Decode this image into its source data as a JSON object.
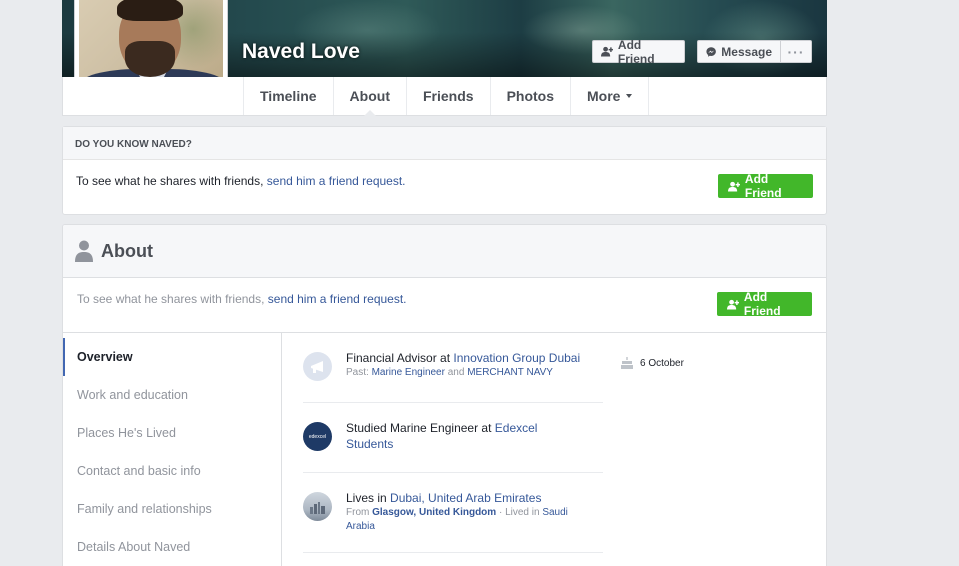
{
  "profile": {
    "name": "Naved Love"
  },
  "header_actions": {
    "add_friend": "Add Friend",
    "message": "Message",
    "more": "···"
  },
  "nav": {
    "tabs": [
      {
        "label": "Timeline"
      },
      {
        "label": "About"
      },
      {
        "label": "Friends"
      },
      {
        "label": "Photos"
      },
      {
        "label": "More"
      }
    ],
    "active_tab": "About"
  },
  "know_card": {
    "title": "DO YOU KNOW NAVED?",
    "text": "To see what he shares with friends, ",
    "link": "send him a friend request.",
    "button": "Add Friend"
  },
  "about": {
    "title": "About",
    "request_text": "To see what he shares with friends, ",
    "request_link": "send him a friend request.",
    "button": "Add Friend",
    "sidebar": [
      {
        "label": "Overview"
      },
      {
        "label": "Work and education"
      },
      {
        "label": "Places He's Lived"
      },
      {
        "label": "Contact and basic info"
      },
      {
        "label": "Family and relationships"
      },
      {
        "label": "Details About Naved"
      }
    ],
    "active_section": "Overview",
    "entries": [
      {
        "icon": "briefcase-icon",
        "main_prefix": "Financial Advisor at ",
        "main_link": "Innovation Group Dubai",
        "sub_prefix": "Past: ",
        "sub_link1": "Marine Engineer",
        "sub_mid": " and ",
        "sub_link2": "MERCHANT NAVY"
      },
      {
        "icon": "school-logo-icon",
        "logo_text": "edexcel",
        "main_prefix": "Studied Marine Engineer at ",
        "main_link": "Edexcel Students"
      },
      {
        "icon": "city-icon",
        "main_prefix": "Lives in ",
        "main_link": "Dubai, United Arab Emirates",
        "sub_prefix": "From ",
        "sub_link1": "Glasgow, United Kingdom",
        "sub_mid": " · Lived in ",
        "sub_link2": "Saudi Arabia"
      }
    ],
    "birthday": "6 October"
  },
  "colors": {
    "page_bg": "#e9ebee",
    "link": "#365899",
    "green": "#42b72a",
    "active_border": "#4267b2"
  }
}
